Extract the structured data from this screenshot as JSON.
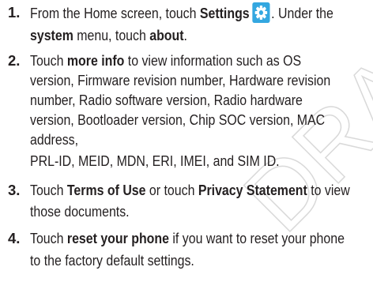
{
  "watermark": {
    "text": "DRAFT",
    "color": "#d9d9d9"
  },
  "icons": {
    "settings": "settings-gear-icon",
    "settings_color": "#34a7e0"
  },
  "steps": [
    {
      "number": "1.",
      "l1_a": "From the Home screen, touch ",
      "l1_b": "Settings",
      "l1_c": ". Under the",
      "l2_a": "system",
      "l2_b": " menu, touch ",
      "l2_c": "about",
      "l2_d": "."
    },
    {
      "number": "2.",
      "l1_a": "Touch ",
      "l1_b": "more info",
      "l1_c": " to view information such as OS",
      "l2": "version, Firmware revision number, Hardware revision",
      "l3": "number, Radio software version, Radio hardware",
      "l4": "version, Bootloader version, Chip SOC version, MAC",
      "l5": "address,",
      "l6": "PRL-ID, MEID, MDN, ERI, IMEI, and SIM ID."
    },
    {
      "number": "3.",
      "l1_a": "Touch ",
      "l1_b": "Terms of Use",
      "l1_c": " or touch ",
      "l1_d": "Privacy Statement",
      "l1_e": " to view",
      "l2": "those documents."
    },
    {
      "number": "4.",
      "l1_a": "Touch ",
      "l1_b": "reset your phone",
      "l1_c": " if you want to reset your phone",
      "l2": "to the factory default settings."
    }
  ]
}
